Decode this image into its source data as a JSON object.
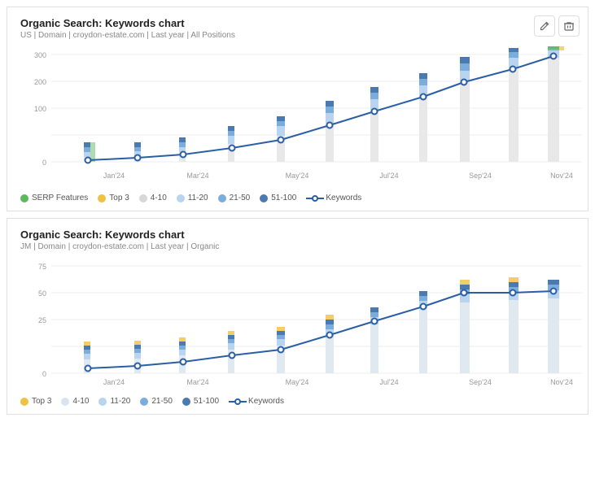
{
  "chart1": {
    "title": "Organic Search: Keywords chart",
    "subtitle": "US | Domain | croydon-estate.com | Last year | All Positions",
    "yLabels": [
      "0",
      "100",
      "200",
      "300"
    ],
    "xLabels": [
      "Jan'24",
      "Mar'24",
      "May'24",
      "Jul'24",
      "Sep'24",
      "Nov'24"
    ],
    "legend": [
      {
        "key": "serp",
        "label": "SERP Features",
        "color": "#5cb85c",
        "type": "dot"
      },
      {
        "key": "top3",
        "label": "Top 3",
        "color": "#f0c040",
        "type": "dot"
      },
      {
        "key": "4-10",
        "label": "4-10",
        "color": "#e8e8e8",
        "type": "dot"
      },
      {
        "key": "11-20",
        "label": "11-20",
        "color": "#b8d4f0",
        "type": "dot"
      },
      {
        "key": "21-50",
        "label": "21-50",
        "color": "#7aacdc",
        "type": "dot"
      },
      {
        "key": "51-100",
        "label": "51-100",
        "color": "#4a7ab0",
        "type": "dot"
      },
      {
        "key": "keywords",
        "label": "Keywords",
        "color": "#2a5fa5",
        "type": "line"
      }
    ],
    "editIcon": "✏️",
    "deleteIcon": "🗑️"
  },
  "chart2": {
    "title": "Organic Search: Keywords chart",
    "subtitle": "JM | Domain | croydon-estate.com | Last year | Organic",
    "yLabels": [
      "0",
      "25",
      "50",
      "75"
    ],
    "xLabels": [
      "Jan'24",
      "Mar'24",
      "May'24",
      "Jul'24",
      "Sep'24",
      "Nov'24"
    ],
    "legend": [
      {
        "key": "top3",
        "label": "Top 3",
        "color": "#f0c040",
        "type": "dot"
      },
      {
        "key": "4-10",
        "label": "4-10",
        "color": "#e0e8f0",
        "type": "dot"
      },
      {
        "key": "11-20",
        "label": "11-20",
        "color": "#b8d4f0",
        "type": "dot"
      },
      {
        "key": "21-50",
        "label": "21-50",
        "color": "#7aacdc",
        "type": "dot"
      },
      {
        "key": "51-100",
        "label": "51-100",
        "color": "#4a7ab0",
        "type": "dot"
      },
      {
        "key": "keywords",
        "label": "Keywords",
        "color": "#2a5fa5",
        "type": "line"
      }
    ]
  }
}
